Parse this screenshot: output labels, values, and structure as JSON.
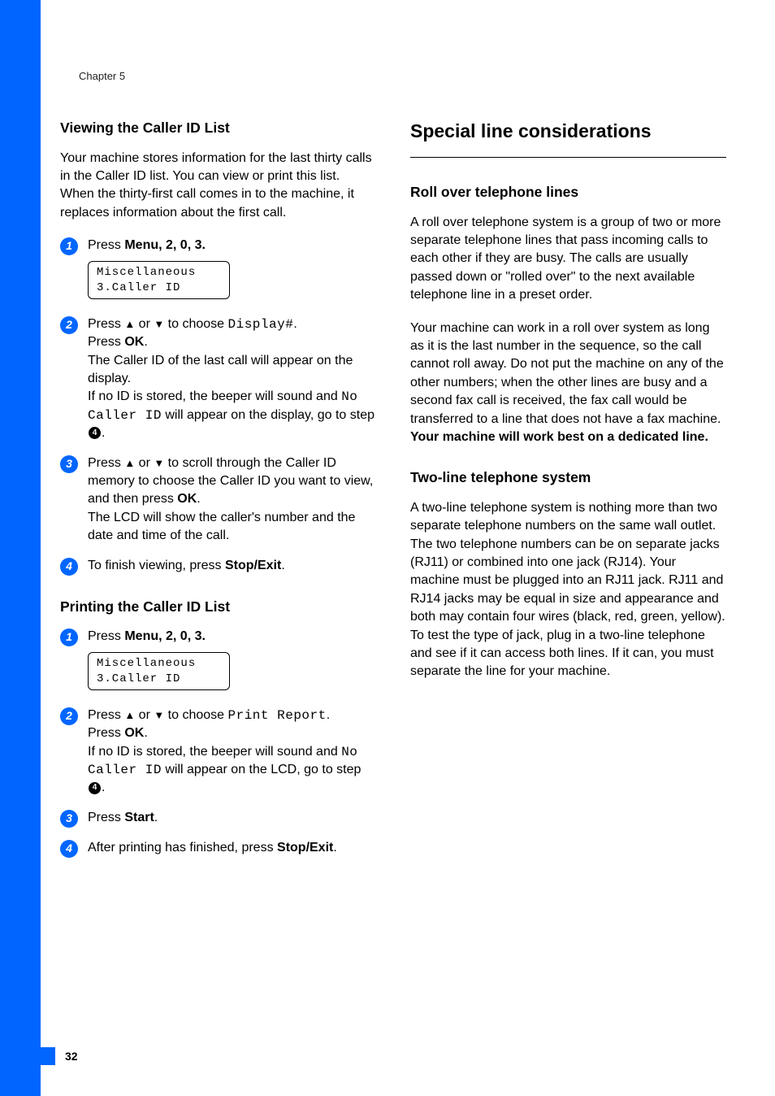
{
  "chapter": "Chapter 5",
  "page_number": "32",
  "left": {
    "h_viewing": "Viewing the Caller ID List",
    "intro_viewing": "Your machine stores information for the last thirty calls in the Caller ID list. You can view or print this list. When the thirty-first call comes in to the machine, it replaces information about the first call.",
    "step1_prefix": "Press ",
    "menu": "Menu",
    "step1_suffix": ", 2, 0, 3.",
    "lcd_line1": "Miscellaneous",
    "lcd_line2": "3.Caller ID",
    "step2_prefix": "Press ",
    "step2_mid": " or ",
    "step2_choose": " to choose ",
    "display_hash": "Display#",
    "step2_period": ".",
    "press_ok_pre": "Press ",
    "ok": "OK",
    "press_ok_post": ".",
    "step2_line3": "The Caller ID of the last call will appear on the display.",
    "step2_line4a": "If no ID is stored, the beeper will sound and ",
    "no_caller_id": "No Caller ID",
    "step2_line4b": " will appear on the display, go to step ",
    "step2_line4c": ".",
    "step3_a": "Press ",
    "step3_b": " or ",
    "step3_c": " to scroll through the Caller ID memory to choose the Caller ID you want to view, and then press ",
    "step3_d": ".",
    "step3_e": "The LCD will show the caller's number and the date and time of the call.",
    "step4_a": "To finish viewing, press ",
    "stop_exit": "Stop/Exit",
    "step4_b": ".",
    "h_printing": "Printing the Caller ID List",
    "pstep2_choose": " to choose ",
    "print_report": "Print Report",
    "pstep2_line3a": "If no ID is stored, the beeper will sound and ",
    "pstep2_line3b": " will appear on the LCD, go to step ",
    "pstep3_a": "Press ",
    "start": "Start",
    "pstep3_b": ".",
    "pstep4_a": "After printing has finished, press ",
    "pstep4_b": "."
  },
  "right": {
    "h_special": "Special line considerations",
    "h_rollover": "Roll over telephone lines",
    "rollover_p1": "A roll over telephone system is a group of two or more separate telephone lines that pass incoming calls to each other if they are busy. The calls are usually passed down or \"rolled over\" to the next available telephone line in a preset order.",
    "rollover_p2a": "Your machine can work in a roll over system as long as it is the last number in the sequence, so the call cannot roll away. Do not put the machine on any of the other numbers; when the other lines are busy and a second fax call is received, the fax call would be transferred to a line that does not have a fax machine. ",
    "rollover_p2b": "Your machine will work best on a dedicated line.",
    "h_twoline": "Two-line telephone system",
    "twoline_p1": "A two-line telephone system is nothing more than two separate telephone numbers on the same wall outlet. The two telephone numbers can be on separate jacks (RJ11) or combined into one jack (RJ14). Your machine must be plugged into an RJ11 jack. RJ11 and RJ14 jacks may be equal in size and appearance and both may contain four wires (black, red, green, yellow). To test the type of jack, plug in a two-line telephone and see if it can access both lines. If it can, you must separate the line for your machine."
  }
}
